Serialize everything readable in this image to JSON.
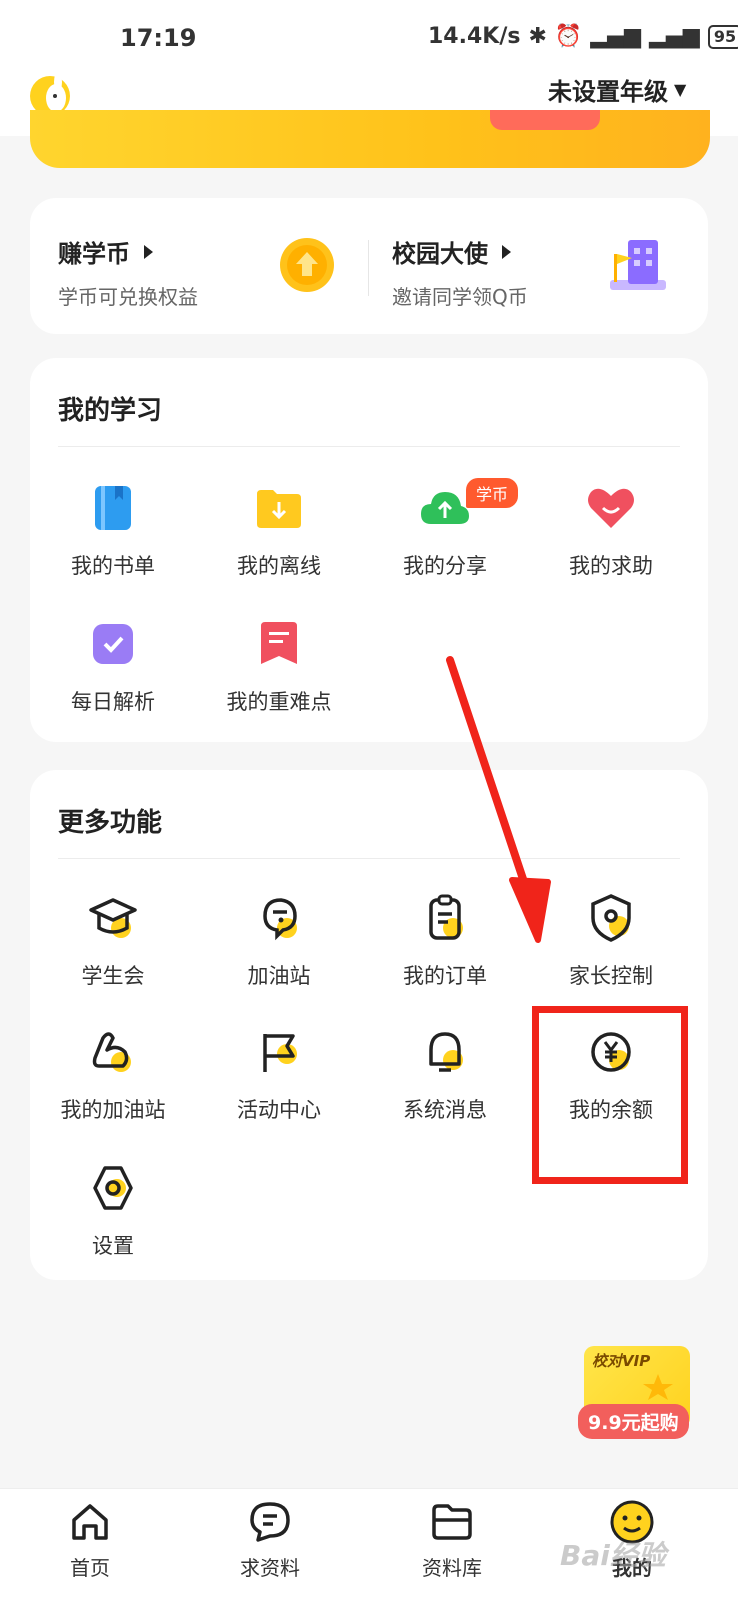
{
  "status": {
    "time": "17:19",
    "speed": "14.4K/s",
    "battery": "95"
  },
  "header": {
    "grade": "未设置年级"
  },
  "coins": {
    "earn_title": "赚学币",
    "earn_sub": "学币可兑换权益",
    "ambassador_title": "校园大使",
    "ambassador_sub": "邀请同学领Q币"
  },
  "study": {
    "title": "我的学习",
    "items": [
      {
        "label": "我的书单"
      },
      {
        "label": "我的离线"
      },
      {
        "label": "我的分享",
        "tag": "学币"
      },
      {
        "label": "我的求助"
      },
      {
        "label": "每日解析"
      },
      {
        "label": "我的重难点"
      }
    ]
  },
  "more": {
    "title": "更多功能",
    "items": [
      {
        "label": "学生会"
      },
      {
        "label": "加油站"
      },
      {
        "label": "我的订单"
      },
      {
        "label": "家长控制"
      },
      {
        "label": "我的加油站"
      },
      {
        "label": "活动中心"
      },
      {
        "label": "系统消息"
      },
      {
        "label": "我的余额"
      },
      {
        "label": "设置"
      }
    ]
  },
  "vip": {
    "label": "校对VIP",
    "price": "9.9元起购"
  },
  "tabs": [
    {
      "label": "首页"
    },
    {
      "label": "求资料"
    },
    {
      "label": "资料库"
    },
    {
      "label": "我的"
    }
  ],
  "watermark": "Bai经验",
  "colors": {
    "accent": "#ffd21e",
    "annotation": "#f0241a",
    "tag": "#ff5a2e"
  }
}
